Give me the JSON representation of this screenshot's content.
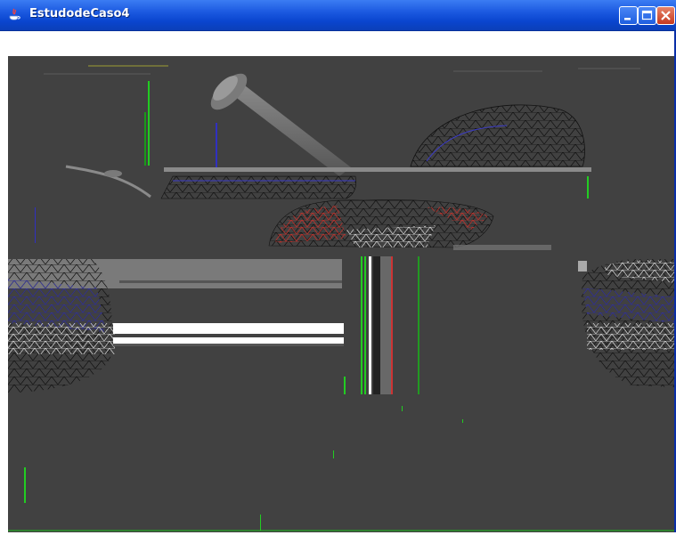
{
  "window": {
    "title": "EstudodeCaso4",
    "controls": [
      "minimize-icon",
      "maximize-icon",
      "close-icon"
    ]
  },
  "colors": {
    "titlebar": "#0a45cf",
    "canvas_bg": "#414141",
    "wire_dark": "#111111",
    "wire_blue": "#4a4ad0",
    "wire_red": "#c0302a",
    "green_artifact": "#22cc22"
  }
}
